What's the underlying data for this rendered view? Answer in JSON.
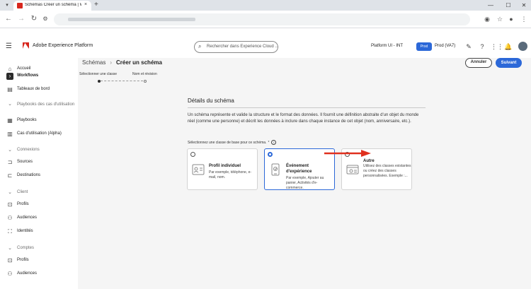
{
  "browser": {
    "tab_title": "Schémas Créer un schéma | Wo",
    "tab_close": "×",
    "new_tab": "+",
    "menu_glyph": "▾",
    "minimize": "—",
    "maximize": "☐",
    "close": "✕"
  },
  "header": {
    "app_title": "Adobe Experience Platform",
    "search_placeholder": "Rechercher dans Experience Cloud ...",
    "org": "Platform UI - INT",
    "sandbox_badge": "Prod",
    "sandbox_name": "Prod (VA7)"
  },
  "sidebar": {
    "items": [
      {
        "label": "Accueil",
        "icon": "home-icon"
      },
      {
        "label": "Workflows",
        "icon": "workflows-icon",
        "active": true
      },
      {
        "label": "Tableaux de bord",
        "icon": "dashboards-icon"
      },
      {
        "label": "Playbooks des cas d'utilisation",
        "icon": "chevron-down-icon",
        "section": true
      },
      {
        "label": "Playbooks",
        "icon": "playbooks-icon"
      },
      {
        "label": "Cas d'utilisation (Alpha)",
        "icon": "use-cases-icon"
      },
      {
        "label": "Connexions",
        "icon": "chevron-down-icon",
        "section": true
      },
      {
        "label": "Sources",
        "icon": "sources-icon"
      },
      {
        "label": "Destinations",
        "icon": "destinations-icon"
      },
      {
        "label": "Client",
        "icon": "chevron-down-icon",
        "section": true
      },
      {
        "label": "Profils",
        "icon": "profiles-icon"
      },
      {
        "label": "Audiences",
        "icon": "audiences-icon"
      },
      {
        "label": "Identités",
        "icon": "identities-icon"
      },
      {
        "label": "Comptes",
        "icon": "chevron-down-icon",
        "section": true
      },
      {
        "label": "Profils",
        "icon": "profiles-icon"
      },
      {
        "label": "Audiences",
        "icon": "audiences-icon"
      }
    ]
  },
  "main": {
    "breadcrumb": {
      "root": "Schémas",
      "separator": "›",
      "current": "Créer un schéma"
    },
    "cancel_label": "Annuler",
    "next_label": "Suivant",
    "steps": [
      {
        "label": "Sélectionner une classe",
        "state": "current"
      },
      {
        "label": "Nom et révision",
        "state": "pending"
      }
    ],
    "section_title": "Détails du schéma",
    "description": "Un schéma représente et valide la structure et le format des données. Il fournit une définition abstraite d'un objet du monde réel (comme une personne) et décrit les données à inclure dans chaque instance de cet objet (nom, anniversaire, etc.).",
    "base_class_label": "Sélectionnez une classe de base pour ce schéma.",
    "required_mark": "*",
    "info_glyph": "i",
    "options": [
      {
        "title": "Profil individuel",
        "desc": "Par exemple, téléphone, e-mail, nom.",
        "selected": false
      },
      {
        "title": "Événement d'expérience",
        "desc": "Par exemple, Ajouter au panier, Activités d'e-commerce.",
        "selected": true
      },
      {
        "title": "Autre",
        "desc": "Utilisez des classes existantes ou créez des classes personnalisées. Exemple :...",
        "selected": false
      }
    ]
  },
  "colors": {
    "accent": "#2c68d8",
    "brand": "#d7261d",
    "arrow": "#e0301e"
  }
}
